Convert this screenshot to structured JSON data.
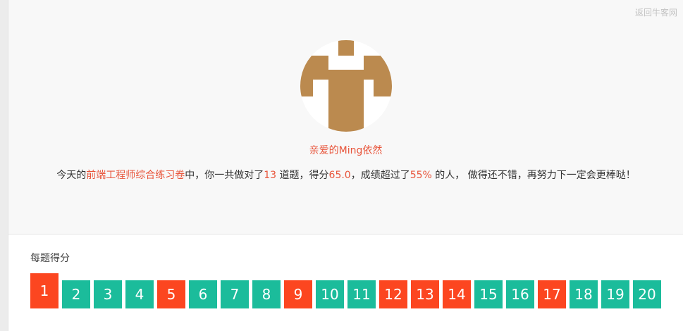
{
  "header": {
    "back_link": "返回牛客网"
  },
  "user": {
    "name": "亲爱的Ming依然"
  },
  "summary": {
    "p1": "今天的",
    "paper": "前端工程师综合练习卷",
    "p2": "中，你一共做对了",
    "correct": "13",
    "p3": " 道题，得分",
    "score": "65.0",
    "p4": "，成绩超过了",
    "percent": "55%",
    "p5": " 的人， 做得还不错，再努力下一定会更棒哒！"
  },
  "scores": {
    "title": "每题得分",
    "items": [
      {
        "n": "1",
        "correct": false
      },
      {
        "n": "2",
        "correct": true
      },
      {
        "n": "3",
        "correct": true
      },
      {
        "n": "4",
        "correct": true
      },
      {
        "n": "5",
        "correct": false
      },
      {
        "n": "6",
        "correct": true
      },
      {
        "n": "7",
        "correct": true
      },
      {
        "n": "8",
        "correct": true
      },
      {
        "n": "9",
        "correct": false
      },
      {
        "n": "10",
        "correct": true
      },
      {
        "n": "11",
        "correct": true
      },
      {
        "n": "12",
        "correct": false
      },
      {
        "n": "13",
        "correct": false
      },
      {
        "n": "14",
        "correct": false
      },
      {
        "n": "15",
        "correct": true
      },
      {
        "n": "16",
        "correct": true
      },
      {
        "n": "17",
        "correct": false
      },
      {
        "n": "18",
        "correct": true
      },
      {
        "n": "19",
        "correct": true
      },
      {
        "n": "20",
        "correct": true
      }
    ]
  },
  "colors": {
    "correct": "#1bbc9b",
    "wrong": "#fc4620",
    "highlight": "#e8543a",
    "avatar": "#bb8a4f"
  }
}
